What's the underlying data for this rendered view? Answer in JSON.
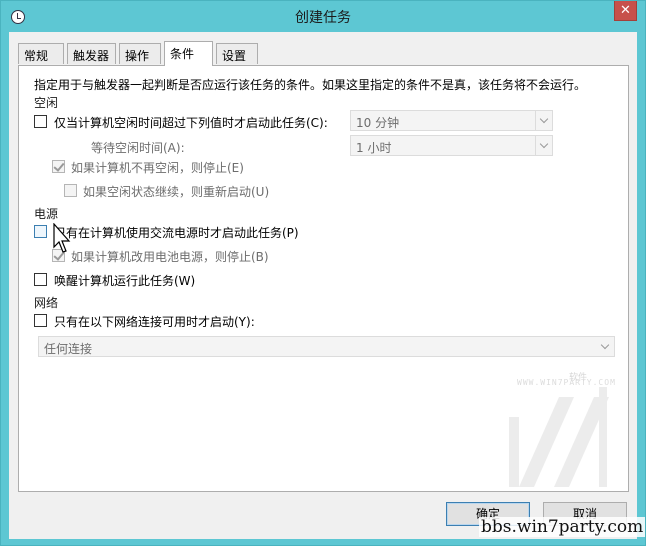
{
  "window": {
    "title": "创建任务",
    "close_symbol": "✕"
  },
  "tabs": [
    "常规",
    "触发器",
    "操作",
    "条件",
    "设置"
  ],
  "active_tab": "条件",
  "description": "指定用于与触发器一起判断是否应运行该任务的条件。如果这里指定的条件不是真，该任务将不会运行。",
  "idle": {
    "section": "空闲",
    "start_if_idle": {
      "label": "仅当计算机空闲时间超过下列值时才启动此任务(C):",
      "checked": false
    },
    "idle_duration": "10 分钟",
    "wait_label": "等待空闲时间(A):",
    "wait_value": "1 小时",
    "stop_if_not_idle": {
      "label": "如果计算机不再空闲，则停止(E)",
      "checked": true,
      "enabled": false
    },
    "restart_if_idle": {
      "label": "如果空闲状态继续，则重新启动(U)",
      "checked": false,
      "enabled": false
    }
  },
  "power": {
    "section": "电源",
    "ac_only": {
      "label": "只有在计算机使用交流电源时才启动此任务(P)",
      "checked": false
    },
    "stop_on_battery": {
      "label": "如果计算机改用电池电源，则停止(B)",
      "checked": true,
      "enabled": false
    },
    "wake": {
      "label": "唤醒计算机运行此任务(W)",
      "checked": false
    }
  },
  "network": {
    "section": "网络",
    "network_only": {
      "label": "只有在以下网络连接可用时才启动(Y):",
      "checked": false
    },
    "connection": "任何连接"
  },
  "watermark_text": {
    "line1": "软件",
    "line2": "WWW.WIN7PARTY.COM"
  },
  "buttons": {
    "ok": "确定",
    "cancel": "取消"
  },
  "site_watermark": "bbs.win7party.com",
  "colors": {
    "titlebar": "#5dc7d3",
    "close": "#c7514b",
    "accent_border": "#3c7fb1"
  }
}
